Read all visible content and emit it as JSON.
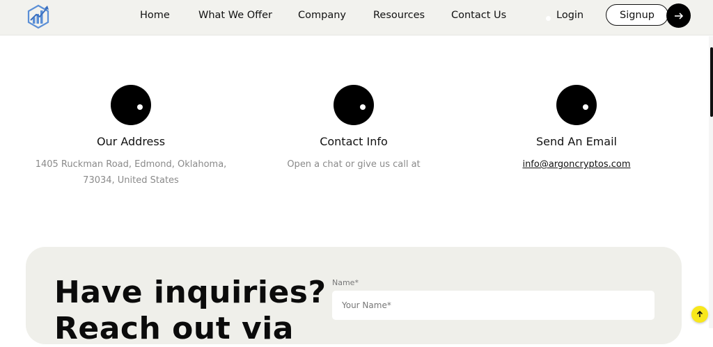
{
  "header": {
    "nav": [
      {
        "label": "Home"
      },
      {
        "label": "What We Offer"
      },
      {
        "label": "Company"
      },
      {
        "label": "Resources"
      },
      {
        "label": "Contact Us"
      }
    ],
    "login_label": "Login",
    "signup_label": "Signup"
  },
  "cards": [
    {
      "title": "Our Address",
      "text_line1": "1405 Ruckman Road, Edmond, Oklahoma,",
      "text_line2": "73034, United States"
    },
    {
      "title": "Contact Info",
      "text_line1": "Open a chat or give us call at"
    },
    {
      "title": "Send An Email",
      "link": "info@argoncryptos.com"
    }
  ],
  "inquiry": {
    "heading_line1": "Have inquiries?",
    "heading_line2": "Reach out via",
    "name_label": "Name*",
    "name_placeholder": "Your Name*"
  },
  "icons": {
    "logo": "bar-chart-hexagon-logo",
    "signup_arrow": "arrow-right-icon",
    "to_top": "arrow-up-icon"
  },
  "colors": {
    "header_bg": "#f2f2ee",
    "section_bg": "#efefea",
    "accent_yellow": "#f8e71c",
    "logo_blue": "#5b8fd6"
  }
}
